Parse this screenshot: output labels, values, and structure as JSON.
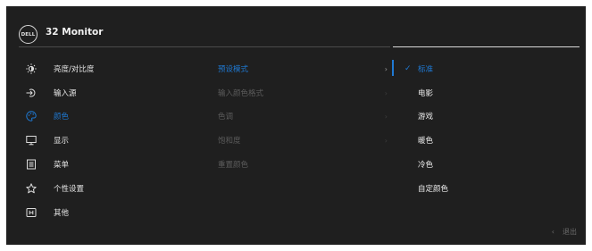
{
  "header": {
    "brand": "DELL",
    "model": "32 Monitor"
  },
  "menu": [
    {
      "label": "亮度/对比度",
      "icon": "brightness-icon",
      "active": false
    },
    {
      "label": "输入源",
      "icon": "input-source-icon",
      "active": false
    },
    {
      "label": "颜色",
      "icon": "color-palette-icon",
      "active": true
    },
    {
      "label": "显示",
      "icon": "display-icon",
      "active": false
    },
    {
      "label": "菜单",
      "icon": "menu-icon",
      "active": false
    },
    {
      "label": "个性设置",
      "icon": "star-icon",
      "active": false
    },
    {
      "label": "其他",
      "icon": "other-icon",
      "active": false
    }
  ],
  "submenu": [
    {
      "label": "预设模式",
      "selected": true
    },
    {
      "label": "输入颜色格式",
      "selected": false
    },
    {
      "label": "色调",
      "selected": false
    },
    {
      "label": "饱和度",
      "selected": false
    },
    {
      "label": "重置颜色",
      "selected": false
    }
  ],
  "options": [
    {
      "label": "标准",
      "selected": true
    },
    {
      "label": "电影",
      "selected": false
    },
    {
      "label": "游戏",
      "selected": false
    },
    {
      "label": "暖色",
      "selected": false
    },
    {
      "label": "冷色",
      "selected": false
    },
    {
      "label": "自定颜色",
      "selected": false
    }
  ],
  "footer": {
    "exit_label": "退出"
  },
  "colors": {
    "accent": "#1f79d3",
    "background": "#1f1f1f",
    "dim_text": "#5c5c5c"
  }
}
